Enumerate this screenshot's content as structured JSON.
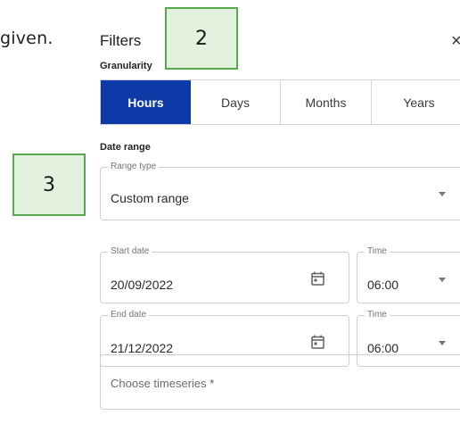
{
  "intro_text": "given.",
  "panel": {
    "title": "Filters",
    "close_label": "×"
  },
  "callouts": {
    "c2": "2",
    "c3": "3"
  },
  "granularity": {
    "label": "Granularity",
    "options": [
      "Hours",
      "Days",
      "Months",
      "Years"
    ],
    "selected": "Hours"
  },
  "date_range": {
    "label": "Date range",
    "range_type": {
      "label": "Range type",
      "value": "Custom range"
    },
    "start": {
      "label": "Start date",
      "value": "20/09/2022",
      "time_label": "Time",
      "time_value": "06:00"
    },
    "end": {
      "label": "End date",
      "value": "21/12/2022",
      "time_label": "Time",
      "time_value": "06:00"
    }
  },
  "timeseries": {
    "placeholder": "Choose timeseries",
    "required_mark": "*"
  },
  "colors": {
    "accent": "#0d3aa6",
    "callout_bg": "#e3f1df",
    "callout_border": "#5aa84d"
  }
}
